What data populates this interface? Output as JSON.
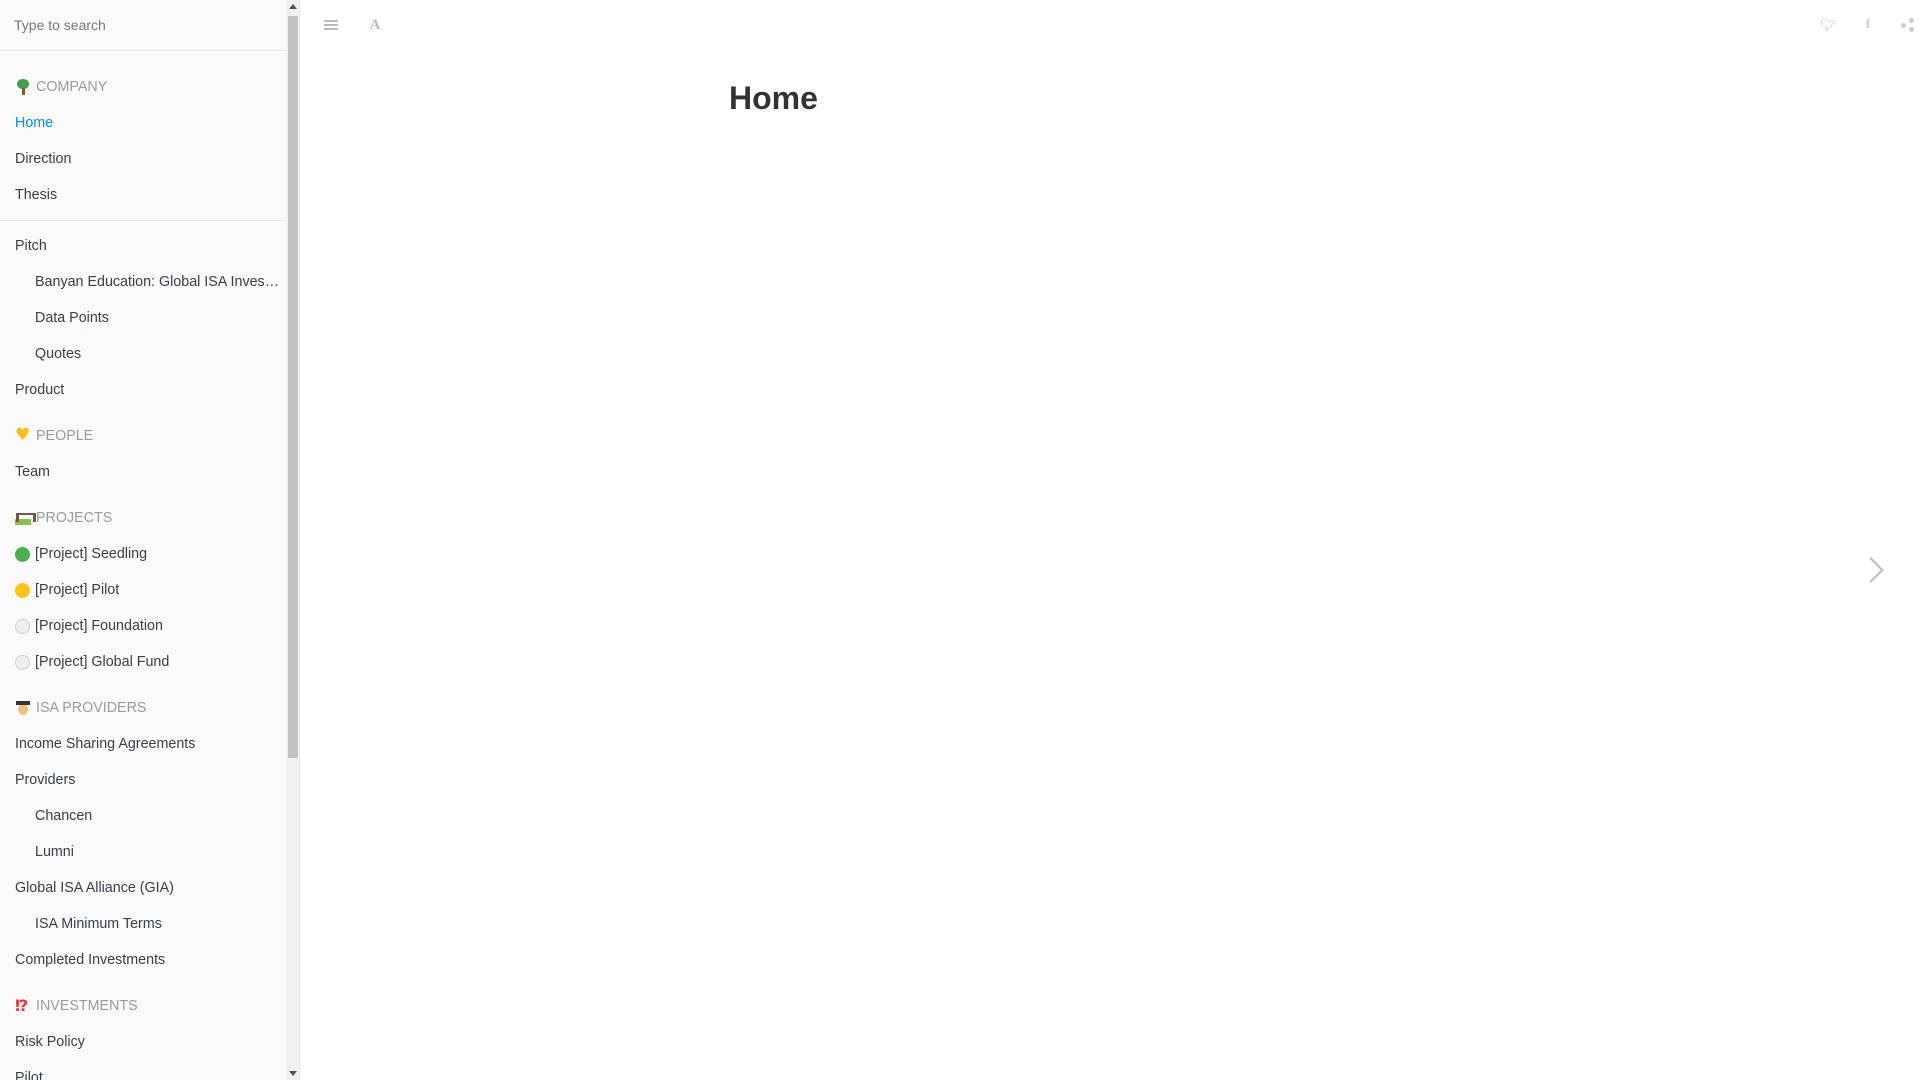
{
  "search": {
    "placeholder": "Type to search"
  },
  "sidebar": {
    "sections": [
      {
        "header": "COMPANY",
        "header_icon": "deciduous-tree-icon",
        "items": [
          {
            "label": "Home",
            "active": true
          },
          {
            "label": "Direction"
          },
          {
            "label": "Thesis"
          }
        ]
      },
      {
        "items": [
          {
            "label": "Pitch"
          },
          {
            "label": "Banyan Education: Global ISA Investment Fund",
            "sub": true
          },
          {
            "label": "Data Points",
            "sub": true
          },
          {
            "label": "Quotes",
            "sub": true
          },
          {
            "label": "Product"
          }
        ]
      },
      {
        "header": "PEOPLE",
        "header_icon": "yellow-heart-icon",
        "items": [
          {
            "label": "Team"
          }
        ]
      },
      {
        "header": "PROJECTS",
        "header_icon": "construction-icon",
        "items": [
          {
            "label": "[Project] Seedling",
            "icon": "green-circle-icon"
          },
          {
            "label": "[Project] Pilot",
            "icon": "yellow-circle-icon"
          },
          {
            "label": "[Project] Foundation",
            "icon": "white-circle-icon"
          },
          {
            "label": "[Project] Global Fund",
            "icon": "white-circle-icon"
          }
        ]
      },
      {
        "header": "ISA PROVIDERS",
        "header_icon": "graduate-icon",
        "items": [
          {
            "label": "Income Sharing Agreements"
          },
          {
            "label": "Providers"
          },
          {
            "label": "Chancen",
            "sub": true
          },
          {
            "label": "Lumni",
            "sub": true
          },
          {
            "label": "Global ISA Alliance (GIA)"
          },
          {
            "label": "ISA Minimum Terms",
            "sub": true
          },
          {
            "label": "Completed Investments"
          }
        ]
      },
      {
        "header": "INVESTMENTS",
        "header_icon": "exclamation-question-icon",
        "items": [
          {
            "label": "Risk Policy"
          },
          {
            "label": "Pilot"
          }
        ]
      }
    ]
  },
  "page": {
    "title": "Home"
  },
  "colors": {
    "active_link": "#008cff",
    "header_text": "#939da3",
    "link_text": "#364149"
  }
}
